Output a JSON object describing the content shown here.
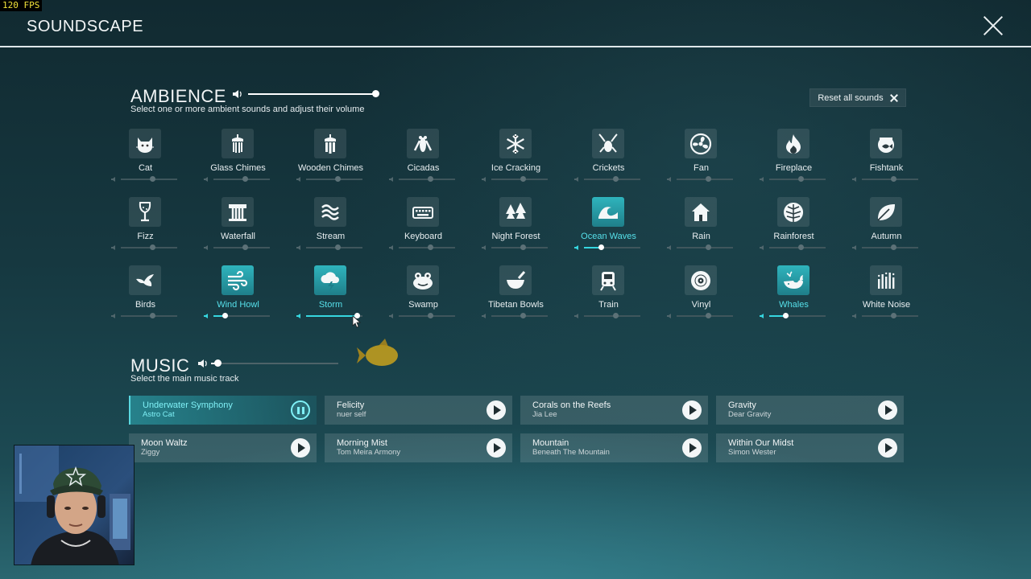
{
  "fps": "120 FPS",
  "header": {
    "title": "SOUNDSCAPE"
  },
  "ambience": {
    "title": "AMBIENCE",
    "subtitle": "Select one or more ambient sounds and adjust their volume",
    "volume": 1.0,
    "reset_label": "Reset all sounds",
    "items": [
      {
        "label": "Cat",
        "icon": "cat-icon",
        "active": false,
        "volume": 0
      },
      {
        "label": "Glass Chimes",
        "icon": "glass-chimes-icon",
        "active": false,
        "volume": 0
      },
      {
        "label": "Wooden Chimes",
        "icon": "wooden-chimes-icon",
        "active": false,
        "volume": 0
      },
      {
        "label": "Cicadas",
        "icon": "cicada-icon",
        "active": false,
        "volume": 0
      },
      {
        "label": "Ice Cracking",
        "icon": "snowflake-icon",
        "active": false,
        "volume": 0
      },
      {
        "label": "Crickets",
        "icon": "cricket-icon",
        "active": false,
        "volume": 0
      },
      {
        "label": "Fan",
        "icon": "fan-icon",
        "active": false,
        "volume": 0
      },
      {
        "label": "Fireplace",
        "icon": "fire-icon",
        "active": false,
        "volume": 0
      },
      {
        "label": "Fishtank",
        "icon": "fishbowl-icon",
        "active": false,
        "volume": 0
      },
      {
        "label": "Fizz",
        "icon": "wine-glass-icon",
        "active": false,
        "volume": 0
      },
      {
        "label": "Waterfall",
        "icon": "waterfall-icon",
        "active": false,
        "volume": 0
      },
      {
        "label": "Stream",
        "icon": "stream-icon",
        "active": false,
        "volume": 0
      },
      {
        "label": "Keyboard",
        "icon": "keyboard-icon",
        "active": false,
        "volume": 0
      },
      {
        "label": "Night Forest",
        "icon": "pine-trees-icon",
        "active": false,
        "volume": 0
      },
      {
        "label": "Ocean Waves",
        "icon": "wave-icon",
        "active": true,
        "volume": 0.3
      },
      {
        "label": "Rain",
        "icon": "house-rain-icon",
        "active": false,
        "volume": 0
      },
      {
        "label": "Rainforest",
        "icon": "monstera-leaf-icon",
        "active": false,
        "volume": 0
      },
      {
        "label": "Autumn",
        "icon": "leaf-icon",
        "active": false,
        "volume": 0
      },
      {
        "label": "Birds",
        "icon": "bird-icon",
        "active": false,
        "volume": 0
      },
      {
        "label": "Wind Howl",
        "icon": "wind-icon",
        "active": true,
        "volume": 0.2
      },
      {
        "label": "Storm",
        "icon": "storm-cloud-icon",
        "active": true,
        "volume": 0.9
      },
      {
        "label": "Swamp",
        "icon": "frog-icon",
        "active": false,
        "volume": 0
      },
      {
        "label": "Tibetan Bowls",
        "icon": "singing-bowl-icon",
        "active": false,
        "volume": 0
      },
      {
        "label": "Train",
        "icon": "train-icon",
        "active": false,
        "volume": 0
      },
      {
        "label": "Vinyl",
        "icon": "vinyl-icon",
        "active": false,
        "volume": 0
      },
      {
        "label": "Whales",
        "icon": "whale-icon",
        "active": true,
        "volume": 0.28
      },
      {
        "label": "White Noise",
        "icon": "noise-bars-icon",
        "active": false,
        "volume": 0
      }
    ]
  },
  "music": {
    "title": "MUSIC",
    "subtitle": "Select the main music track",
    "volume": 0.05,
    "tracks": [
      {
        "name": "Underwater Symphony",
        "artist": "Astro Cat",
        "playing": true
      },
      {
        "name": "Felicity",
        "artist": "nuer self",
        "playing": false
      },
      {
        "name": "Corals on the Reefs",
        "artist": "Jia Lee",
        "playing": false
      },
      {
        "name": "Gravity",
        "artist": "Dear Gravity",
        "playing": false
      },
      {
        "name": "Moon Waltz",
        "artist": "Ziggy",
        "playing": false
      },
      {
        "name": "Morning Mist",
        "artist": "Tom Meira Armony",
        "playing": false
      },
      {
        "name": "Mountain",
        "artist": "Beneath The Mountain",
        "playing": false
      },
      {
        "name": "Within Our Midst",
        "artist": "Simon Wester",
        "playing": false
      }
    ]
  },
  "colors": {
    "accent": "#36d7e0",
    "active_label": "#56e0ea"
  }
}
